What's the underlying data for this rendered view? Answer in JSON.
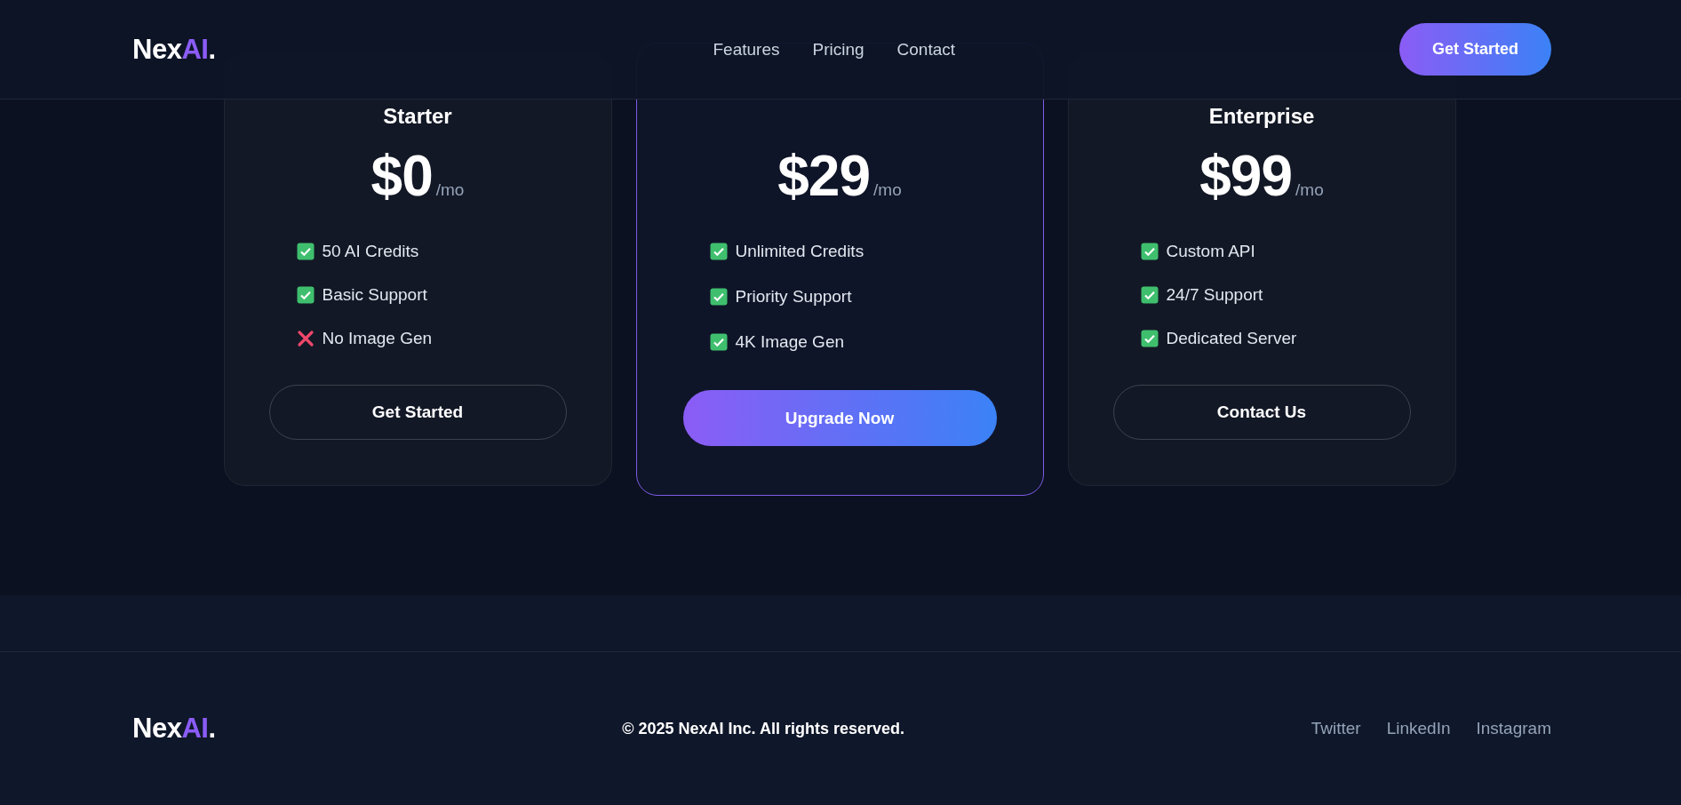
{
  "header": {
    "logo": [
      {
        "text": "Nex",
        "accent": false
      },
      {
        "text": "AI",
        "accent": true
      },
      {
        "text": ".",
        "accent": false
      }
    ],
    "nav": [
      "Features",
      "Pricing",
      "Contact"
    ],
    "cta": "Get Started"
  },
  "plans": [
    {
      "title": "Starter",
      "featured": false,
      "price": "$0",
      "period": "/mo",
      "features": [
        {
          "text": "50 AI Credits",
          "included": true
        },
        {
          "text": "Basic Support",
          "included": true
        },
        {
          "text": "No Image Gen",
          "included": false
        }
      ],
      "button": "Get Started"
    },
    {
      "featured": true,
      "price": "$29",
      "period": "/mo",
      "features": [
        {
          "text": "Unlimited Credits",
          "included": true
        },
        {
          "text": "Priority Support",
          "included": true
        },
        {
          "text": "4K Image Gen",
          "included": true
        }
      ],
      "button": "Upgrade Now"
    },
    {
      "title": "Enterprise",
      "featured": false,
      "price": "$99",
      "period": "/mo",
      "features": [
        {
          "text": "Custom API",
          "included": true
        },
        {
          "text": "24/7 Support",
          "included": true
        },
        {
          "text": "Dedicated Server",
          "included": true
        }
      ],
      "button": "Contact Us"
    }
  ],
  "footer": {
    "logo": [
      {
        "text": "Nex",
        "accent": false
      },
      {
        "text": "AI",
        "accent": true
      },
      {
        "text": ".",
        "accent": false
      }
    ],
    "copyright": "© 2025 NexAI Inc. All rights reserved.",
    "links": [
      "Twitter",
      "LinkedIn",
      "Instagram"
    ]
  }
}
